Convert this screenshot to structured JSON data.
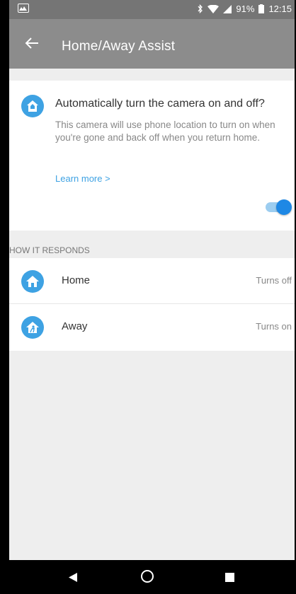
{
  "status_bar": {
    "battery": "91%",
    "time": "12:15",
    "icons": [
      "gallery-icon",
      "bluetooth-icon",
      "wifi-icon",
      "signal-icon",
      "battery-icon"
    ]
  },
  "app_bar": {
    "back_icon": "back-arrow-icon",
    "title": "Home/Away Assist"
  },
  "assist_card": {
    "icon": "house-icon",
    "title": "Automatically turn the camera on and off?",
    "description": "This camera will use phone location to turn on when you're gone and back off when you return home.",
    "learn_more": "Learn more >",
    "toggle_on": true,
    "accent_color": "#3ea2e3"
  },
  "section_header": "HOW IT RESPONDS",
  "responses": [
    {
      "icon": "home-icon",
      "label": "Home",
      "value": "Turns off"
    },
    {
      "icon": "away-icon",
      "label": "Away",
      "value": "Turns on"
    }
  ],
  "nav_bar": {
    "buttons": [
      "back-triangle-icon",
      "home-circle-icon",
      "recents-square-icon"
    ]
  }
}
